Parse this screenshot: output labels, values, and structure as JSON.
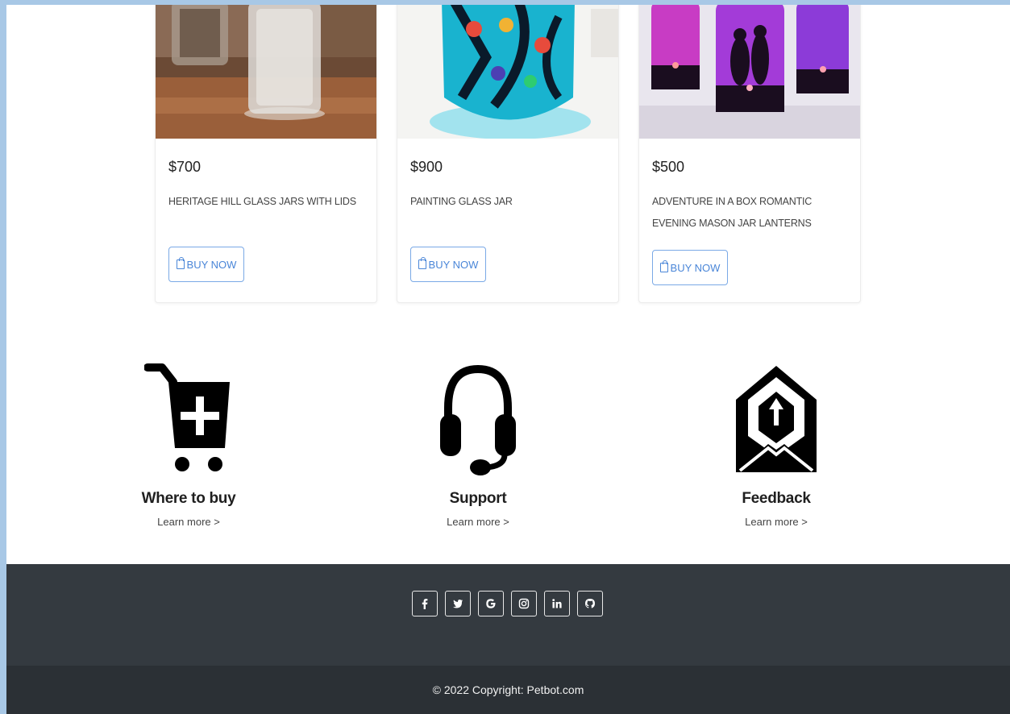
{
  "products": [
    {
      "price": "$700",
      "title": "HERITAGE HILL GLASS JARS WITH LIDS",
      "buy_label": "BUY NOW",
      "image": "glass-jars-photo"
    },
    {
      "price": "$900",
      "title": "PAINTING GLASS JAR",
      "buy_label": "BUY NOW",
      "image": "painted-jar-photo"
    },
    {
      "price": "$500",
      "title": "ADVENTURE IN A BOX ROMANTIC EVENING MASON JAR LANTERNS",
      "buy_label": "BUY NOW",
      "image": "jar-lanterns-photo"
    }
  ],
  "features": [
    {
      "title": "Where to buy",
      "link": "Learn more >",
      "icon": "cart-plus-icon"
    },
    {
      "title": "Support",
      "link": "Learn more >",
      "icon": "headset-icon"
    },
    {
      "title": "Feedback",
      "link": "Learn more >",
      "icon": "envelope-upload-icon"
    }
  ],
  "social": [
    {
      "name": "facebook-icon",
      "glyph": "f"
    },
    {
      "name": "twitter-icon",
      "glyph": "t"
    },
    {
      "name": "google-icon",
      "glyph": "G"
    },
    {
      "name": "instagram-icon",
      "glyph": "i"
    },
    {
      "name": "linkedin-icon",
      "glyph": "in"
    },
    {
      "name": "github-icon",
      "glyph": "gh"
    }
  ],
  "footer": {
    "copyright": "© 2022 Copyright: Petbot.com"
  },
  "colors": {
    "footer_top": "#343a40",
    "footer_bottom": "#2b3035",
    "button_accent": "#4a86d8"
  }
}
